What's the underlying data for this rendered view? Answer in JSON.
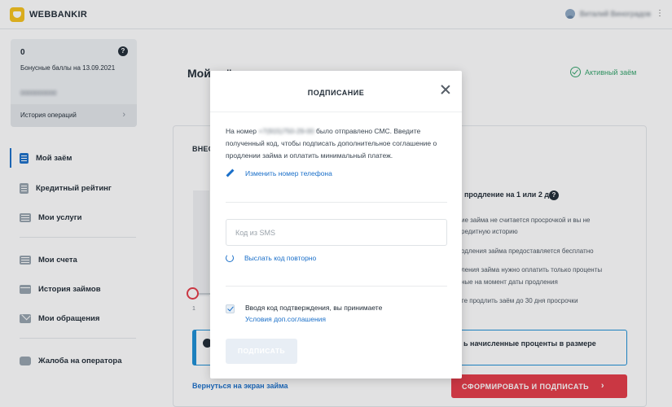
{
  "header": {
    "brand": "WEBBANKIR",
    "user_name": "Виталий Виноградов"
  },
  "sidebar": {
    "bonus": {
      "value": "0",
      "label": "Бонусные баллы на 13.09.2021",
      "account_masked": "0000000000",
      "history_label": "История операций"
    },
    "items": [
      {
        "label": "Мой заём",
        "icon": "document-icon",
        "active": true
      },
      {
        "label": "Кредитный рейтинг",
        "icon": "rating-icon",
        "active": false
      },
      {
        "label": "Мои услуги",
        "icon": "services-icon",
        "active": false
      },
      {
        "label": "Мои счета",
        "icon": "accounts-icon",
        "active": false
      },
      {
        "label": "История займов",
        "icon": "calendar-icon",
        "active": false
      },
      {
        "label": "Мои обращения",
        "icon": "mail-icon",
        "active": false
      },
      {
        "label": "Жалоба на оператора",
        "icon": "chat-icon",
        "active": false
      }
    ]
  },
  "main": {
    "title": "Мой заём",
    "status": "Активный заём",
    "card_heading": "ВНЕС",
    "slider_min": "1",
    "extension": {
      "title": "продление на 1 или 2 дня",
      "lines": [
        "ие займа не считается просрочкой и вы не",
        "редитную историю",
        "одления займа предоставляется бесплатно",
        "ления займа нужно оплатить только проценты",
        "ные на момент даты продления",
        "те продлить заём до 30 дня просрочки"
      ]
    },
    "alert_text": "ь начисленные проценты в размере",
    "back_link": "Вернуться на экран займа",
    "submit_label": "СФОРМИРОВАТЬ И ПОДПИСАТЬ"
  },
  "modal": {
    "title": "ПОДПИСАНИЕ",
    "sms_prefix": "На номер",
    "phone_masked": "+7(915)750-29-00",
    "sms_suffix": "было отправлено СМС. Введите полученный код, чтобы подписать дополнительное соглашение о продлении займа и оплатить минимальный платеж.",
    "change_phone": "Изменить номер телефона",
    "code_placeholder": "Код из SMS",
    "code_value": "",
    "resend": "Выслать код повторно",
    "agree_checked": true,
    "agree_text": "Вводя код подтверждения, вы принимаете",
    "agree_link": "Условия доп.соглашения",
    "sign_button": "ПОДПИСАТЬ"
  },
  "colors": {
    "accent_blue": "#1a6fc9",
    "danger_red": "#e53a46",
    "success_green": "#33a36b",
    "brand_yellow": "#f6c21b"
  }
}
